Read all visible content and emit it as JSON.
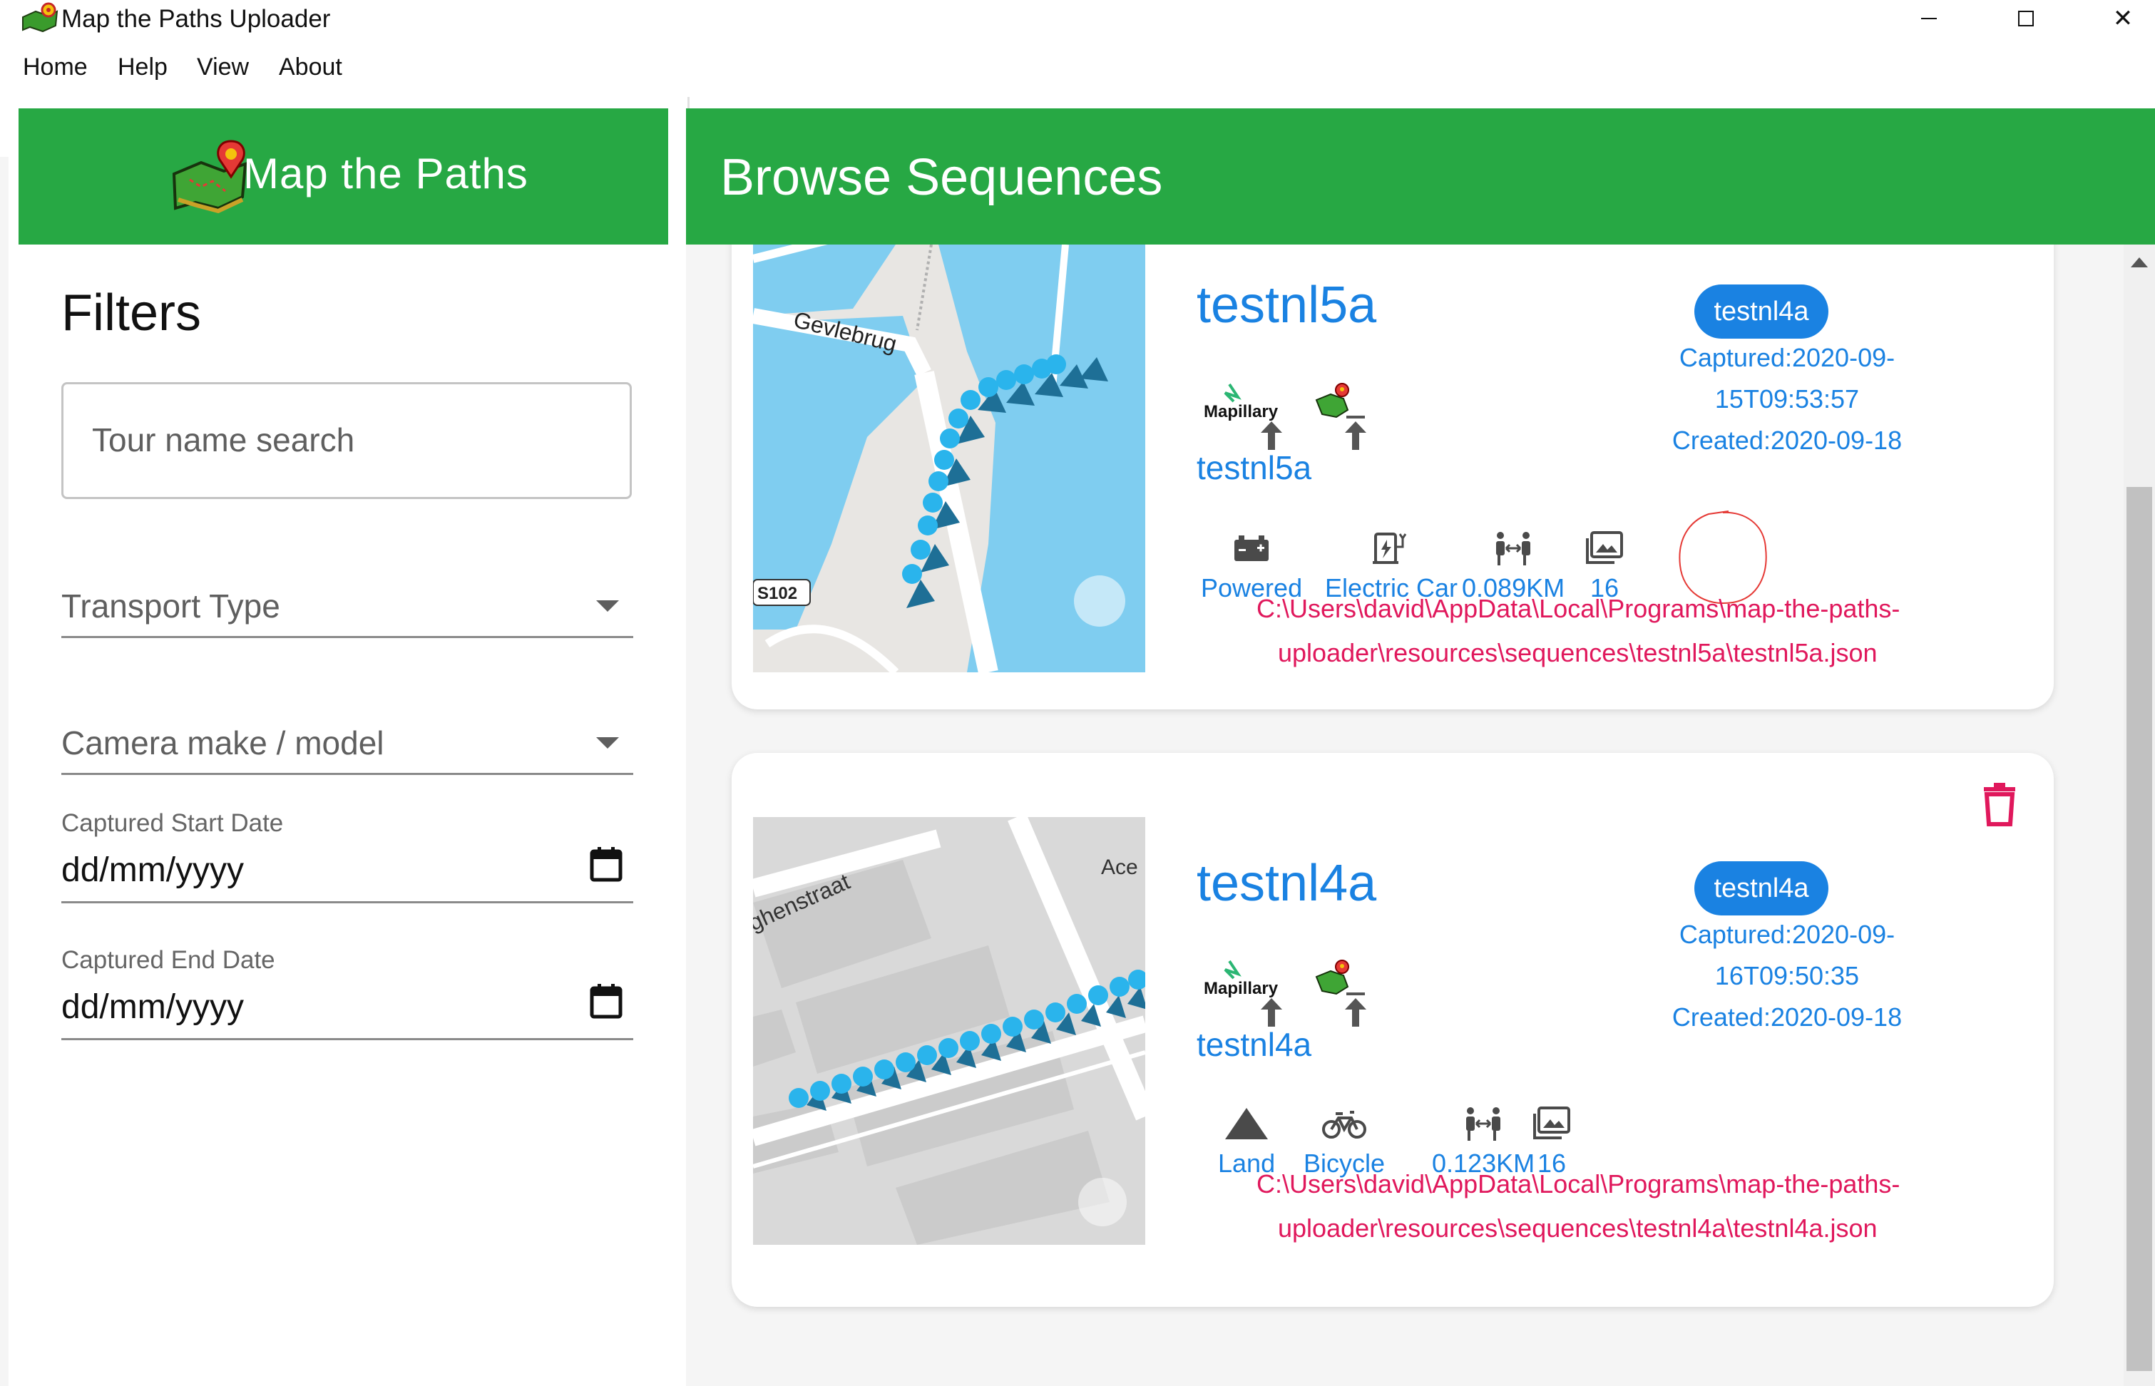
{
  "window": {
    "title": "Map the Paths Uploader",
    "icons": {
      "app": "app-logo-icon",
      "minimize": "minimize-icon",
      "maximize": "maximize-icon",
      "close": "close-icon"
    }
  },
  "menu": {
    "items": [
      {
        "label": "Home"
      },
      {
        "label": "Help"
      },
      {
        "label": "View"
      },
      {
        "label": "About"
      }
    ]
  },
  "sidebar": {
    "brand": "Map the Paths",
    "filters_title": "Filters",
    "search_placeholder": "Tour name search",
    "transport_label": "Transport Type",
    "camera_label": "Camera make / model",
    "start_date_label": "Captured Start Date",
    "start_date_value": "dd/mm/yyyy",
    "end_date_label": "Captured End Date",
    "end_date_value": "dd/mm/yyyy"
  },
  "main": {
    "title": "Browse Sequences",
    "colors": {
      "header": "#27a844",
      "accent": "#1a82e2",
      "path": "#e0185c",
      "delete": "#e0185c"
    },
    "sequences": [
      {
        "name": "testnl5a",
        "tag": "testnl4a",
        "captured": "Captured:2020-09-",
        "captured_time": "15T09:53:57",
        "created": "Created:2020-09-18",
        "provider_label": "Mapillary",
        "provider_name": "testnl5a",
        "map_labels": {
          "street": "Gevlebrug",
          "road_badge": "S102"
        },
        "stats": [
          {
            "icon": "battery-icon",
            "label": "Powered"
          },
          {
            "icon": "electric-car-icon",
            "label": "Electric Car"
          },
          {
            "icon": "distance-icon",
            "label": "0.089KM"
          },
          {
            "icon": "photos-icon",
            "label": "16"
          }
        ],
        "path_line1": "C:\\Users\\david\\AppData\\Local\\Programs\\map-the-paths-",
        "path_line2": "uploader\\resources\\sequences\\testnl5a\\testnl5a.json"
      },
      {
        "name": "testnl4a",
        "tag": "testnl4a",
        "captured": "Captured:2020-09-",
        "captured_time": "16T09:50:35",
        "created": "Created:2020-09-18",
        "provider_label": "Mapillary",
        "provider_name": "testnl4a",
        "map_labels": {
          "street": "ghenstraat",
          "corner": "Ace"
        },
        "stats": [
          {
            "icon": "mountain-icon",
            "label": "Land"
          },
          {
            "icon": "bicycle-icon",
            "label": "Bicycle"
          },
          {
            "icon": "distance-icon",
            "label": "0.123KM"
          },
          {
            "icon": "photos-icon",
            "label": "16"
          }
        ],
        "path_line1": "C:\\Users\\david\\AppData\\Local\\Programs\\map-the-paths-",
        "path_line2": "uploader\\resources\\sequences\\testnl4a\\testnl4a.json"
      }
    ]
  }
}
